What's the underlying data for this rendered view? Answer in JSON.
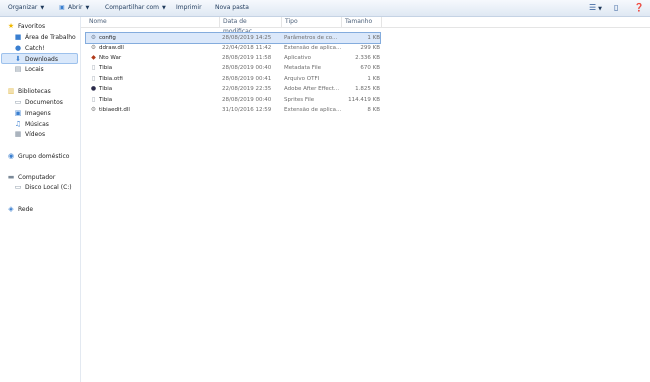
{
  "toolbar": {
    "organize": "Organizar",
    "open": "Abrir",
    "share": "Compartilhar com",
    "print": "Imprimir",
    "new_folder": "Nova pasta"
  },
  "nav": {
    "favorites": "Favoritos",
    "desktop": "Área de Trabalho",
    "catch": "Catch!",
    "downloads": "Downloads",
    "places": "Locais",
    "libraries": "Bibliotecas",
    "documents": "Documentos",
    "images": "Imagens",
    "music": "Músicas",
    "videos": "Vídeos",
    "homegroup": "Grupo doméstico",
    "computer": "Computador",
    "local_disk": "Disco Local (C:)",
    "network": "Rede"
  },
  "columns": {
    "name": "Nome",
    "date": "Data de modificaç...",
    "type": "Tipo",
    "size": "Tamanho"
  },
  "files": [
    {
      "name": "config",
      "date": "28/08/2019 14:25",
      "type": "Parâmetros de co...",
      "size": "1 KB",
      "icon": "config-file-icon"
    },
    {
      "name": "ddraw.dll",
      "date": "22/04/2018 11:42",
      "type": "Extensão de aplica...",
      "size": "299 KB",
      "icon": "dll-file-icon"
    },
    {
      "name": "Nto War",
      "date": "28/08/2019 11:58",
      "type": "Aplicativo",
      "size": "2.336 KB",
      "icon": "app-icon"
    },
    {
      "name": "Tibia",
      "date": "28/08/2019 00:40",
      "type": "Metadata File",
      "size": "670 KB",
      "icon": "file-icon"
    },
    {
      "name": "Tibia.otfi",
      "date": "28/08/2019 00:41",
      "type": "Arquivo OTFI",
      "size": "1 KB",
      "icon": "file-icon"
    },
    {
      "name": "Tibia",
      "date": "22/08/2019 22:35",
      "type": "Adobe After Effect...",
      "size": "1.825 KB",
      "icon": "after-effects-file-icon"
    },
    {
      "name": "Tibia",
      "date": "28/08/2019 00:40",
      "type": "Sprites File",
      "size": "114.419 KB",
      "icon": "file-icon"
    },
    {
      "name": "tibiaedit.dll",
      "date": "31/10/2016 12:59",
      "type": "Extensão de aplica...",
      "size": "8 KB",
      "icon": "dll-file-icon"
    }
  ]
}
